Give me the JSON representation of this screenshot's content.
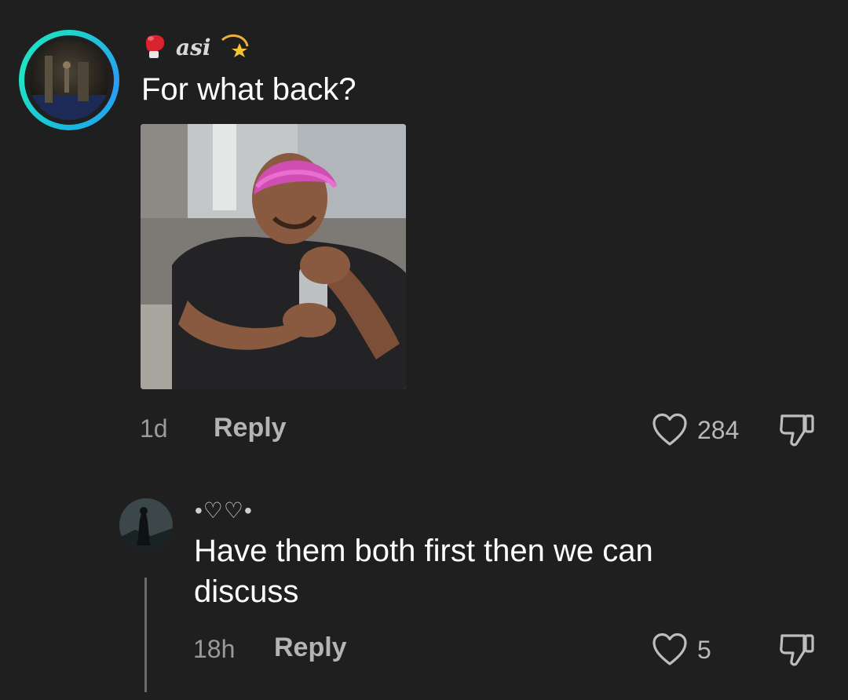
{
  "comment": {
    "username": "asi",
    "text": "For what back?",
    "time": "1d",
    "reply_label": "Reply",
    "likes": "284"
  },
  "reply": {
    "username": "•♡♡•",
    "text": "Have them both first then we can discuss",
    "time": "18h",
    "reply_label": "Reply",
    "likes": "5"
  },
  "icons": {
    "username_prefix": "boxing-glove-icon",
    "username_suffix": "shooting-star-icon",
    "like": "heart-outline-icon",
    "dislike": "thumbs-down-icon"
  },
  "colors": {
    "background": "#1f1f20",
    "story_ring": "#1fd6c8",
    "muted_text": "#9a9a9a"
  }
}
